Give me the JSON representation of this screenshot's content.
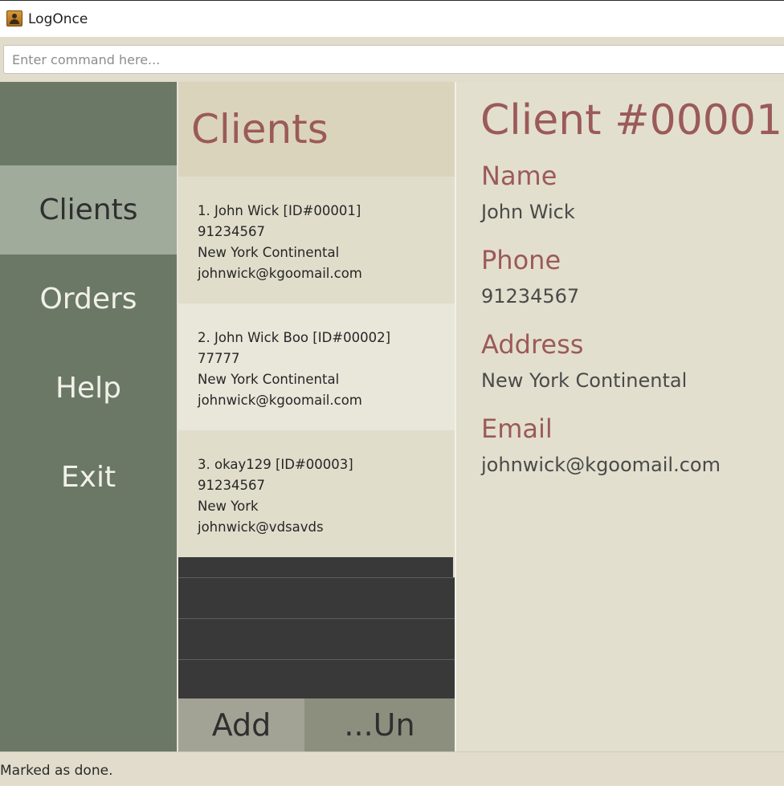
{
  "window": {
    "title": "LogOnce",
    "icon": "contacts-book-icon"
  },
  "command": {
    "placeholder": "Enter command here...",
    "value": ""
  },
  "sidebar": {
    "items": [
      {
        "label": "Clients",
        "active": true
      },
      {
        "label": "Orders",
        "active": false
      },
      {
        "label": "Help",
        "active": false
      },
      {
        "label": "Exit",
        "active": false
      }
    ]
  },
  "list": {
    "title": "Clients",
    "clients": [
      {
        "header": "1.   John Wick [ID#00001]",
        "phone": "91234567",
        "address": "New York Continental",
        "email": "johnwick@kgoomail.com"
      },
      {
        "header": "2.   John Wick Boo [ID#00002]",
        "phone": "77777",
        "address": "New York Continental",
        "email": "johnwick@kgoomail.com"
      },
      {
        "header": "3.   okay129 [ID#00003]",
        "phone": "91234567",
        "address": "New York",
        "email": "johnwick@vdsavds"
      }
    ],
    "add_label": "Add",
    "undo_label": "...Un"
  },
  "detail": {
    "title": "Client #00001",
    "name_label": "Name",
    "name_value": "John Wick",
    "phone_label": "Phone",
    "phone_value": "91234567",
    "address_label": "Address",
    "address_value": "New York Continental",
    "email_label": "Email",
    "email_value": "johnwick@kgoomail.com"
  },
  "status": {
    "text": "Marked as done."
  },
  "colors": {
    "accent": "#9b5a5a",
    "sidebar": "#6b7866",
    "sidebar_active": "#a0ab9b",
    "background": "#e1decd"
  }
}
